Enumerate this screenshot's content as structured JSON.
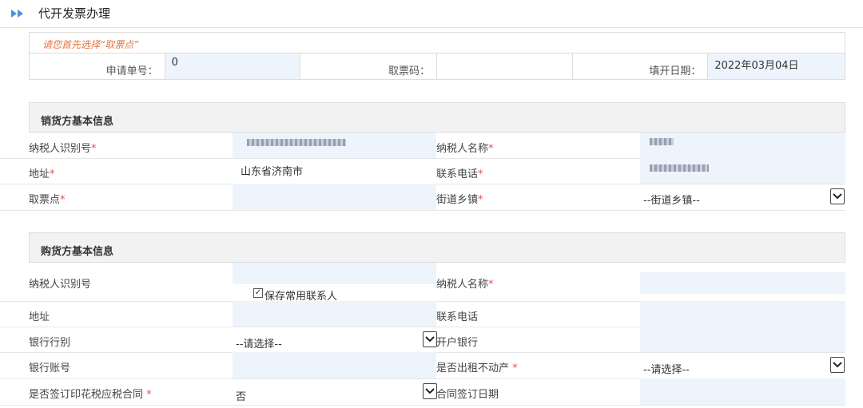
{
  "page": {
    "title": "代开发票办理",
    "title_icon": "double-arrow-right-icon",
    "accent": "#4a90e2"
  },
  "notice": "请您首先选择“取票点”",
  "request": {
    "apply_no_label": "申请单号：",
    "apply_no_value": "0",
    "ticket_code_label": "取票码：",
    "ticket_code_value": "",
    "fill_date_label": "填开日期：",
    "fill_date_value": "2022年03月04日"
  },
  "seller": {
    "header": "销货方基本信息",
    "taxpayer_id_label": "纳税人识别号",
    "taxpayer_name_label": "纳税人名称",
    "address_label": "地址",
    "address_value": "山东省济南市",
    "phone_label": "联系电话",
    "pickup_label": "取票点",
    "street_label": "街道乡镇",
    "street_value": "--街道乡镇--"
  },
  "buyer": {
    "header": "购货方基本信息",
    "taxpayer_id_label": "纳税人识别号",
    "save_contact_label": "保存常用联系人",
    "save_contact_checked": true,
    "taxpayer_name_label": "纳税人名称",
    "address_label": "地址",
    "phone_label": "联系电话",
    "bank_type_label": "银行行别",
    "bank_type_value": "--请选择--",
    "open_bank_label": "开户银行",
    "bank_account_label": "银行账号",
    "rent_property_label": "是否出租不动产",
    "rent_property_value": "--请选择--",
    "stamp_contract_label": "是否签订印花税应税合同",
    "stamp_contract_value": "否",
    "contract_date_label": "合同签订日期"
  },
  "required_mark": "*"
}
